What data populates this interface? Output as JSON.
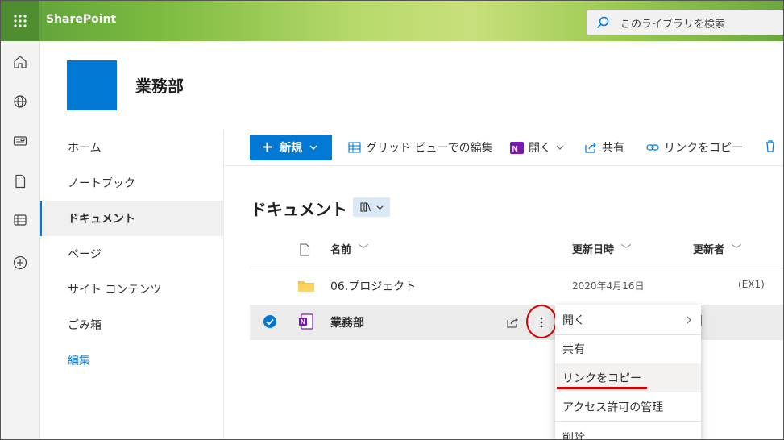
{
  "app": {
    "brand": "SharePoint"
  },
  "search": {
    "placeholder": "このライブラリを検索",
    "icon": "search-icon"
  },
  "rail": {
    "icons": [
      "home-icon",
      "globe-icon",
      "news-icon",
      "file-icon",
      "list-icon",
      "add-icon"
    ]
  },
  "site": {
    "title": "業務部",
    "logo_color": "#0078d4"
  },
  "nav": {
    "items": [
      {
        "label": "ホーム",
        "selected": false
      },
      {
        "label": "ノートブック",
        "selected": false
      },
      {
        "label": "ドキュメント",
        "selected": true
      },
      {
        "label": "ページ",
        "selected": false
      },
      {
        "label": "サイト コンテンツ",
        "selected": false
      },
      {
        "label": "ごみ箱",
        "selected": false
      }
    ],
    "edit_label": "編集"
  },
  "commandbar": {
    "new_label": "新規",
    "grid_edit_label": "グリッド ビューでの編集",
    "open_label": "開く",
    "share_label": "共有",
    "copy_link_label": "リンクをコピー"
  },
  "library": {
    "title": "ドキュメント",
    "columns": {
      "name": "名前",
      "modified": "更新日時",
      "modified_by": "更新者"
    },
    "rows": [
      {
        "type": "folder",
        "name": "06.プロジェクト",
        "modified": "2020年4月16日",
        "modified_by": "(EX1)",
        "selected": false
      },
      {
        "type": "onenote",
        "name": "業務部",
        "modified": "",
        "modified_by": "",
        "selected": true
      }
    ]
  },
  "context_menu": {
    "items": [
      {
        "label": "開く",
        "has_submenu": true
      },
      {
        "label": "共有",
        "has_submenu": false
      },
      {
        "label": "リンクをコピー",
        "has_submenu": false,
        "highlighted": true
      },
      {
        "label": "アクセス許可の管理",
        "has_submenu": false
      },
      {
        "label": "削除",
        "has_submenu": false
      }
    ]
  },
  "colors": {
    "accent": "#0078d4",
    "annotation": "#d60000",
    "onenote": "#7719aa",
    "folder": "#f6c445"
  }
}
